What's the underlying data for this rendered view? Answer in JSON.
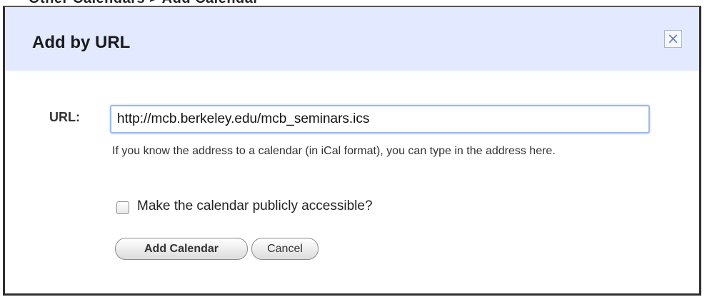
{
  "top_partial_text": "Other Calendars > Add Calendar",
  "dialog": {
    "title": "Add by URL",
    "close_symbol": "×",
    "close_icon": "close-icon"
  },
  "form": {
    "url_label": "URL:",
    "url_value": "http://mcb.berkeley.edu/mcb_seminars.ics",
    "help_text": "If you know the address to a calendar (in iCal format), you can type in the address here.",
    "public_checkbox_checked": false,
    "public_checkbox_label": "Make the calendar publicly accessible?"
  },
  "buttons": {
    "add_label": "Add Calendar",
    "cancel_label": "Cancel"
  },
  "colors": {
    "header_background": "#e3e9ff",
    "input_focus_border": "#9db9e8",
    "close_icon": "#6d83bd"
  }
}
